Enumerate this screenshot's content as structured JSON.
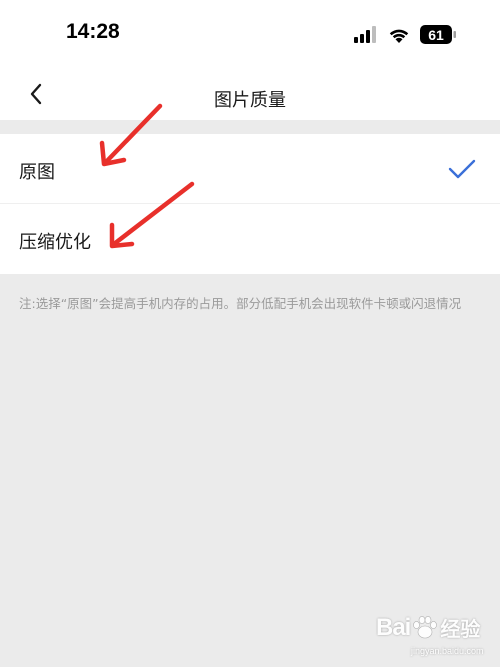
{
  "status_bar": {
    "time": "14:28",
    "battery": "61",
    "icons": [
      "cellular-signal-icon",
      "wifi-icon",
      "battery-icon"
    ]
  },
  "nav": {
    "title": "图片质量",
    "back_icon": "chevron-left-icon"
  },
  "options": [
    {
      "label": "原图",
      "selected": true
    },
    {
      "label": "压缩优化",
      "selected": false
    }
  ],
  "note": "注:选择“原图”会提高手机内存的占用。部分低配手机会出现软件卡顿或闪退情况",
  "colors": {
    "accent": "#3a6fd8",
    "annotation_arrow": "#e8302b",
    "background": "#ebebeb",
    "note_text": "#9a9a9a"
  },
  "watermark": {
    "brand": "Bai",
    "brand_cn": "经验",
    "url": "jingyan.baidu.com"
  }
}
